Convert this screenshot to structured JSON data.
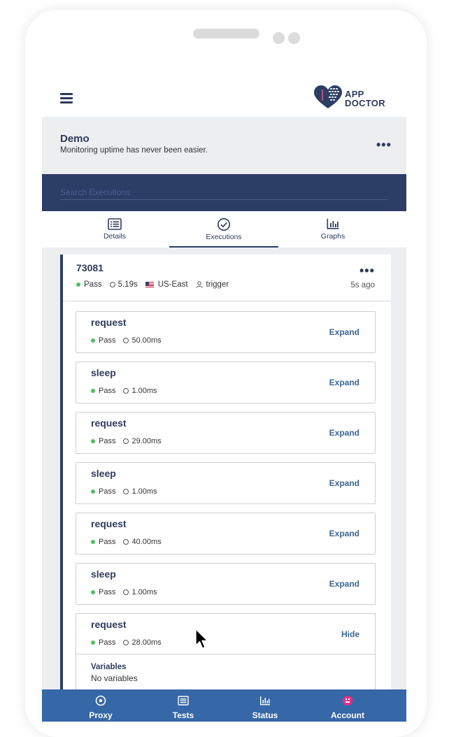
{
  "app": {
    "logo_line1": "APP",
    "logo_line2": "DOCTOR",
    "brand_color": "#2c3e66",
    "accent_color": "#3667a6",
    "pass_color": "#4cc25a"
  },
  "project": {
    "name": "Demo",
    "subtitle": "Monitoring uptime has never been easier.",
    "menu_label": "•••"
  },
  "search": {
    "placeholder": "Search Executions",
    "value": ""
  },
  "tabs": [
    {
      "label": "Details",
      "icon": "list-icon"
    },
    {
      "label": "Executions",
      "icon": "check-circle-icon",
      "active": true
    },
    {
      "label": "Graphs",
      "icon": "bar-chart-icon"
    }
  ],
  "execution": {
    "id": "73081",
    "status": "Pass",
    "duration": "5.19s",
    "region": "US-East",
    "trigger": "trigger",
    "ago": "5s ago",
    "menu_label": "•••"
  },
  "steps": [
    {
      "name": "request",
      "status": "Pass",
      "duration": "50.00ms",
      "action": "Expand"
    },
    {
      "name": "sleep",
      "status": "Pass",
      "duration": "1.00ms",
      "action": "Expand"
    },
    {
      "name": "request",
      "status": "Pass",
      "duration": "29.00ms",
      "action": "Expand"
    },
    {
      "name": "sleep",
      "status": "Pass",
      "duration": "1.00ms",
      "action": "Expand"
    },
    {
      "name": "request",
      "status": "Pass",
      "duration": "40.00ms",
      "action": "Expand"
    },
    {
      "name": "sleep",
      "status": "Pass",
      "duration": "1.00ms",
      "action": "Expand"
    },
    {
      "name": "request",
      "status": "Pass",
      "duration": "28.00ms",
      "action": "Hide",
      "variables_title": "Variables",
      "variables_value": "No variables"
    }
  ],
  "bottom_nav": [
    {
      "label": "Proxy",
      "icon": "target-icon"
    },
    {
      "label": "Tests",
      "icon": "list-icon"
    },
    {
      "label": "Status",
      "icon": "bar-chart-icon"
    },
    {
      "label": "Account",
      "icon": "avatar-icon"
    }
  ]
}
